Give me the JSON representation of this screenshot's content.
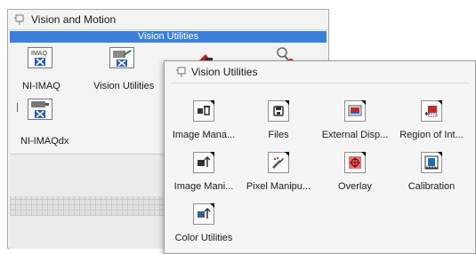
{
  "background_palette": {
    "title": "Vision and Motion",
    "subbar": "Vision Utilities",
    "items": [
      {
        "label": "NI-IMAQ",
        "icon": "ni-imaq-icon",
        "icon_text": "IMAQ"
      },
      {
        "label": "Vision Utilities",
        "icon": "vision-utilities-icon"
      },
      {
        "label": "NI-IMAQdx",
        "icon": "ni-imaqdx-icon"
      }
    ]
  },
  "popup": {
    "title": "Vision Utilities",
    "items": [
      {
        "label": "Image Mana...",
        "icon": "image-management-icon"
      },
      {
        "label": "Files",
        "icon": "files-icon"
      },
      {
        "label": "External Disp...",
        "icon": "external-display-icon"
      },
      {
        "label": "Region of Int...",
        "icon": "region-of-interest-icon"
      },
      {
        "label": "Image Mani...",
        "icon": "image-manipulation-icon"
      },
      {
        "label": "Pixel Manipu...",
        "icon": "pixel-manipulation-icon"
      },
      {
        "label": "Overlay",
        "icon": "overlay-icon"
      },
      {
        "label": "Calibration",
        "icon": "calibration-icon"
      },
      {
        "label": "Color Utilities",
        "icon": "color-utilities-icon"
      }
    ]
  },
  "colors": {
    "highlight": "#3b80d8",
    "popup_bg": "#f5f5f5"
  }
}
